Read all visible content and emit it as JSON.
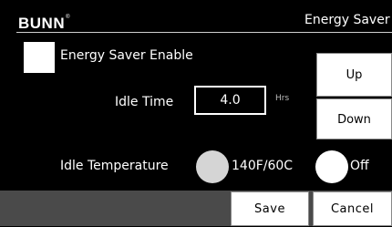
{
  "header": {
    "brand": "BUNN",
    "brand_mark": "®",
    "screen_title": "Energy Saver"
  },
  "energy_saver": {
    "enable_label": "Energy Saver Enable",
    "enabled": false
  },
  "idle_time": {
    "label": "Idle Time",
    "value": "4.0",
    "unit": "Hrs"
  },
  "stepper": {
    "up_label": "Up",
    "down_label": "Down"
  },
  "idle_temperature": {
    "label": "Idle Temperature",
    "option_temp_label": "140F/60C",
    "option_off_label": "Off",
    "selected": "140F/60C"
  },
  "footer": {
    "save_label": "Save",
    "cancel_label": "Cancel"
  },
  "colors": {
    "background": "#000000",
    "footer": "#4a4a4a",
    "radio_selected": "#d5d5d5",
    "radio_unselected": "#ffffff"
  }
}
